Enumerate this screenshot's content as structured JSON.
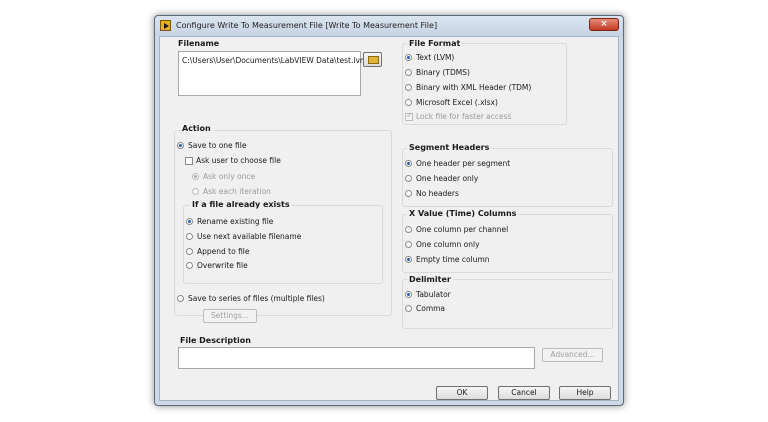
{
  "window": {
    "title": "Configure Write To Measurement File [Write To Measurement File]",
    "close_glyph": "×"
  },
  "filename": {
    "heading": "Filename",
    "value": "C:\\Users\\User\\Documents\\LabVIEW Data\\test.lvm"
  },
  "action": {
    "heading": "Action",
    "save_one": "Save to one file",
    "ask_user": "Ask user to choose file",
    "ask_once": "Ask only once",
    "ask_each": "Ask each iteration",
    "exists_heading": "If a file already exists",
    "rename": "Rename existing file",
    "use_next": "Use next available filename",
    "append": "Append to file",
    "overwrite": "Overwrite file",
    "save_series": "Save to series of files (multiple files)",
    "settings": "Settings..."
  },
  "file_format": {
    "heading": "File Format",
    "text": "Text (LVM)",
    "binary": "Binary (TDMS)",
    "binary_xml": "Binary with XML Header (TDM)",
    "excel": "Microsoft Excel (.xlsx)",
    "lock": "Lock file for faster access"
  },
  "segment_headers": {
    "heading": "Segment Headers",
    "per_segment": "One header per segment",
    "one_only": "One header only",
    "none": "No headers"
  },
  "x_value": {
    "heading": "X Value (Time) Columns",
    "per_channel": "One column per channel",
    "one_only": "One column only",
    "empty": "Empty time column"
  },
  "delimiter": {
    "heading": "Delimiter",
    "tab": "Tabulator",
    "comma": "Comma"
  },
  "description": {
    "heading": "File Description",
    "value": "",
    "advanced": "Advanced..."
  },
  "buttons": {
    "ok": "OK",
    "cancel": "Cancel",
    "help": "Help"
  }
}
